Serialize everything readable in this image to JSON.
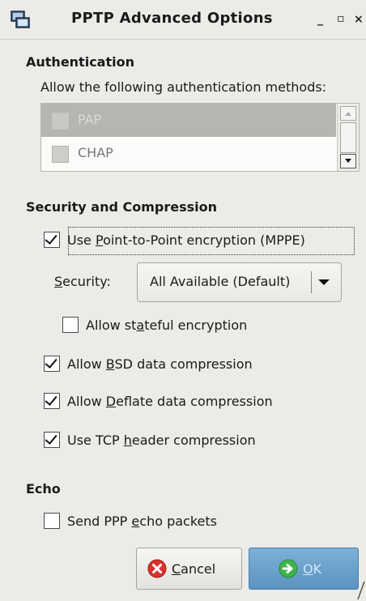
{
  "window": {
    "title": "PPTP Advanced Options",
    "minimize": "_",
    "maximize": "▫",
    "close": "×",
    "icon": "network-window-icon"
  },
  "authentication": {
    "heading": "Authentication",
    "description": "Allow the following authentication methods:",
    "methods": [
      {
        "label": "PAP",
        "checked": false,
        "selected": true
      },
      {
        "label": "CHAP",
        "checked": false,
        "selected": false
      }
    ]
  },
  "security_compression": {
    "heading": "Security and Compression",
    "mppe": {
      "pre": "Use ",
      "underlined": "P",
      "post": "oint-to-Point encryption (MPPE)",
      "checked": true
    },
    "security_label": {
      "underlined": "S",
      "post": "ecurity:"
    },
    "security_value": "All Available (Default)",
    "stateful": {
      "pre": "Allow st",
      "underlined": "a",
      "post": "teful encryption",
      "checked": false
    },
    "bsd": {
      "pre": "Allow ",
      "underlined": "B",
      "post": "SD data compression",
      "checked": true
    },
    "deflate": {
      "pre": "Allow ",
      "underlined": "D",
      "post": "eflate data compression",
      "checked": true
    },
    "tcp": {
      "pre": "Use TCP ",
      "underlined": "h",
      "post": "eader compression",
      "checked": true
    }
  },
  "echo": {
    "heading": "Echo",
    "send": {
      "pre": "Send PPP ",
      "underlined": "e",
      "post": "cho packets",
      "checked": false
    }
  },
  "buttons": {
    "cancel": {
      "underlined": "C",
      "post": "ancel",
      "icon": "cancel-x-icon"
    },
    "ok": {
      "underlined": "O",
      "post": "K",
      "icon": "ok-arrow-icon"
    }
  },
  "colors": {
    "background": "#ecebe8",
    "ok_button": "#5b93c1",
    "cancel_icon": "#d8322e",
    "ok_icon": "#3bb54a"
  }
}
